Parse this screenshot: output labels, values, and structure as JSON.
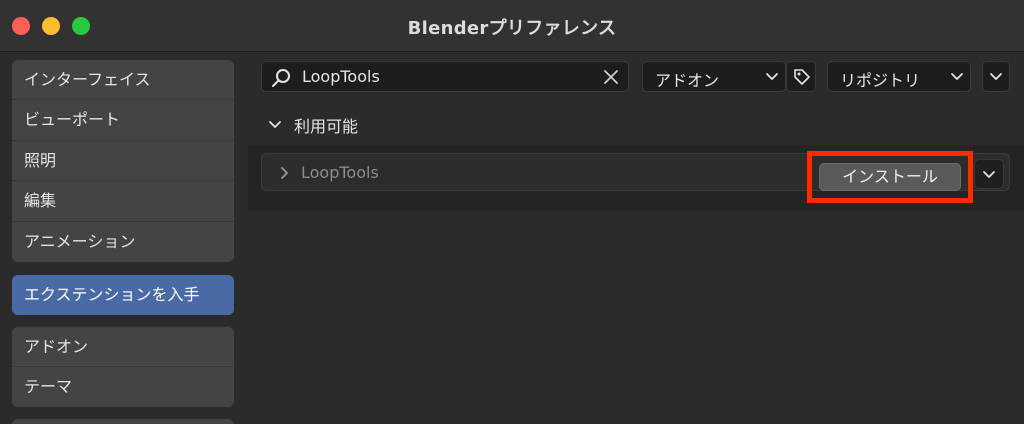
{
  "window": {
    "title": "Blenderプリファレンス"
  },
  "sidebar": {
    "groups": [
      {
        "items": [
          "インターフェイス",
          "ビューポート",
          "照明",
          "編集",
          "アニメーション"
        ]
      },
      {
        "items": [
          "エクステンションを入手"
        ]
      },
      {
        "items": [
          "アドオン",
          "テーマ"
        ]
      }
    ],
    "active_item": "エクステンションを入手"
  },
  "toolbar": {
    "search_value": "LoopTools",
    "type_filter": "アドオン",
    "repository_filter": "リポジトリ"
  },
  "section": {
    "label": "利用可能"
  },
  "extension_row": {
    "name": "LoopTools",
    "install_label": "インストール"
  },
  "colors": {
    "active": "#4a6aa6",
    "highlight_box": "#ff2a00",
    "close": "#ff5f57",
    "minimize": "#febc2e",
    "maximize": "#28c840"
  }
}
